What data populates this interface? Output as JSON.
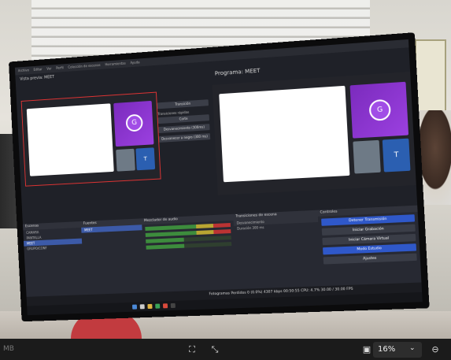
{
  "screen": {
    "preview_title": "Vista previa: MEET",
    "program_title": "Programa: MEET",
    "avatar_letter": "G",
    "avatar_letter_2": "T",
    "transitions_label": "Transiciones rápidas",
    "transition_cut": "Corte",
    "transition_fade": "Desvanecimiento (300ms)",
    "transition_black": "Desvanecer a negro (300 ms)",
    "transition_button": "Transición",
    "docks": {
      "scenes_title": "Escenas",
      "sources_title": "Fuentes",
      "audio_title": "Mezclador de audio",
      "transitions_title": "Transiciones de escena",
      "controls_title": "Controles",
      "scenes": [
        "CAMARA",
        "PANTALLA",
        "MEET",
        "GRUPO/CONF"
      ],
      "sources": [
        "MEET"
      ],
      "transition_value": "Desvanecimiento",
      "duration_label": "Duración",
      "duration_value": "300 ms",
      "controls": [
        "Detener Transmisión",
        "Iniciar Grabación",
        "Iniciar Cámara Virtual",
        "Modo Estudio",
        "Ajustes"
      ]
    },
    "status": "Fotogramas Perdidos 0 (0.0%)   4307 kbps   00:50:55   CPU: 4.7%   30.00 / 30.00 FPS"
  },
  "viewer": {
    "zoom": "16%",
    "zoom_caret": "⌄",
    "left_text": "MB"
  }
}
